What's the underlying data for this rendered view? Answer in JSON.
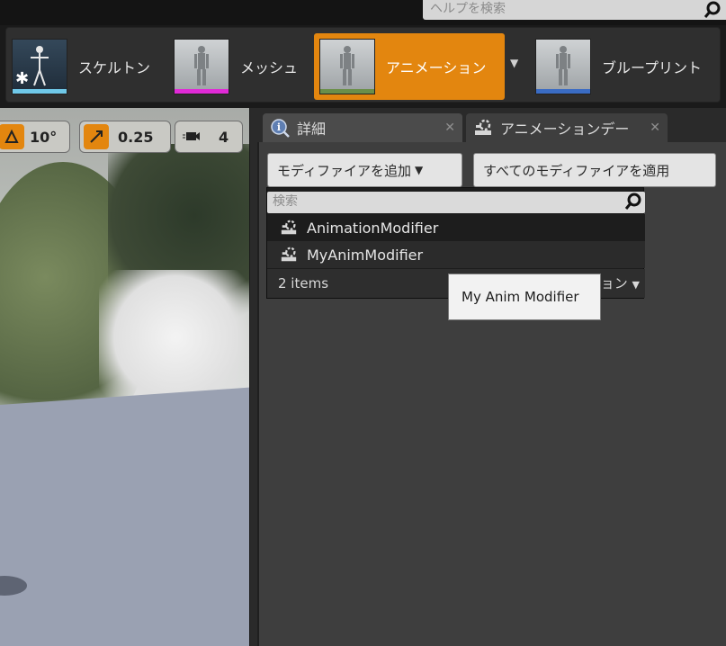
{
  "help": {
    "placeholder": "ヘルプを検索"
  },
  "asset_bar": {
    "items": [
      {
        "label": "スケルトン",
        "bar_color": "#6fc8e8"
      },
      {
        "label": "メッシュ",
        "bar_color": "#e02ad6"
      },
      {
        "label": "アニメーション",
        "bar_color": "#6b8f4a"
      },
      {
        "label": "ブループリント",
        "bar_color": "#3a6cc4"
      }
    ],
    "active_color": "#e3860f"
  },
  "viewport": {
    "rotation_snap": "10°",
    "scale_snap": "0.25",
    "camera_speed": "4"
  },
  "tabs": [
    {
      "label": "詳細"
    },
    {
      "label": "アニメーションデー"
    }
  ],
  "details": {
    "add_modifier": "モディファイアを追加",
    "apply_all": "すべてのモディファイアを適用"
  },
  "dropdown": {
    "search_placeholder": "検索",
    "items": [
      {
        "label": "AnimationModifier"
      },
      {
        "label": "MyAnimModifier"
      }
    ],
    "count": "2 items",
    "view_options_suffix": "ョン"
  },
  "tooltip": {
    "text": "My Anim Modifier"
  }
}
